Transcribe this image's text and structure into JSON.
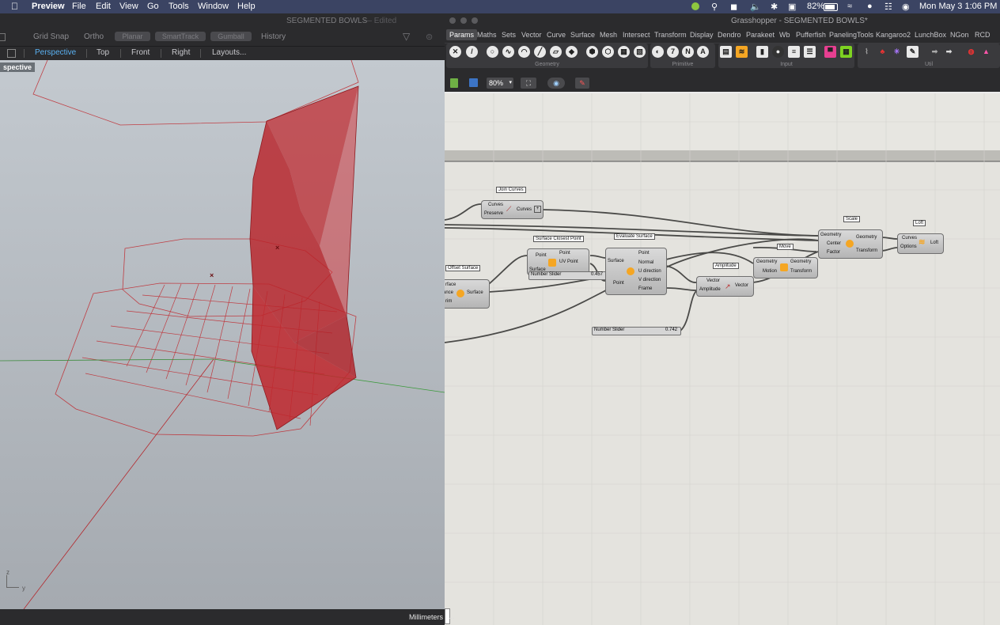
{
  "menubar": {
    "app": "Preview",
    "items": [
      "File",
      "Edit",
      "View",
      "Go",
      "Tools",
      "Window",
      "Help"
    ],
    "battery": "82%",
    "clock": "Mon May 3  1:06 PM"
  },
  "rhino": {
    "doc_title": "SEGMENTED BOWLS",
    "doc_state": "— Edited",
    "toolbar": {
      "grid_snap": "Grid Snap",
      "ortho": "Ortho",
      "planar": "Planar",
      "smarttrack": "SmartTrack",
      "gumball": "Gumball",
      "history": "History"
    },
    "view_tabs": [
      "Perspective",
      "Top",
      "Front",
      "Right",
      "Layouts..."
    ],
    "viewport_label": "spective",
    "axis_z": "z",
    "axis_y": "y",
    "units": "Millimeters"
  },
  "grasshopper": {
    "window_title": "Grasshopper - SEGMENTED BOWLS*",
    "tabs": [
      "Params",
      "Maths",
      "Sets",
      "Vector",
      "Curve",
      "Surface",
      "Mesh",
      "Intersect",
      "Transform",
      "Display",
      "Dendro",
      "Parakeet",
      "Wb",
      "Pufferfish",
      "PanelingTools",
      "Kangaroo2",
      "LunchBox",
      "NGon",
      "RCD"
    ],
    "ribbon_sections": [
      "Geometry",
      "Primitive",
      "Input",
      "Util"
    ],
    "zoom": "80%",
    "status_ellipsis": "...",
    "components": {
      "join_curves": {
        "title": "Join Curves",
        "in1": "Curves",
        "in2": "Preserve",
        "out": "Curves"
      },
      "surface_closest_point": {
        "title": "Surface Closest Point",
        "in1": "Point",
        "in2": "Surface",
        "out1": "Point",
        "out2": "UV Point"
      },
      "evaluate_surface": {
        "title": "Evaluate Surface",
        "in1": "Surface",
        "in2": "Point",
        "out1": "Point",
        "out2": "Normal",
        "out3": "U direction",
        "out4": "V direction",
        "out5": "Frame"
      },
      "offset_surface": {
        "title": "Offset Surface",
        "in1": "rface",
        "in2": "ance",
        "in3": "rim",
        "out": "Surface"
      },
      "amplitude": {
        "title": "Amplitude",
        "in1": "Vector",
        "in2": "Amplitude",
        "out": "Vector"
      },
      "move": {
        "title": "Move",
        "in1": "Geometry",
        "in2": "Motion",
        "out1": "Geometry",
        "out2": "Transform"
      },
      "scale": {
        "title": "Scale",
        "in1": "Geometry",
        "in2": "Center",
        "in3": "Factor",
        "out1": "Geometry",
        "out2": "Transform"
      },
      "loft": {
        "title": "Loft",
        "in1": "Curves",
        "in2": "Options",
        "out": "Loft"
      }
    },
    "sliders": [
      {
        "name": "Number Slider",
        "value": "0.457"
      },
      {
        "name": "Number Slider",
        "value": "0.742"
      }
    ]
  },
  "colors": {
    "menubar": "#3b4463",
    "accent": "#5ab1f2",
    "model_red": "#c0272d"
  }
}
